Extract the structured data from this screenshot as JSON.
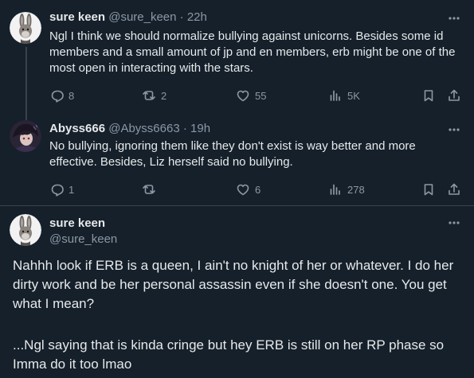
{
  "tweets": [
    {
      "name": "sure keen",
      "handle": "@sure_keen",
      "time": "· 22h",
      "text": "Ngl I think we should normalize bullying against unicorns. Besides some id members and a small amount of jp and en members, erb might be one of the most open in interacting with the stars.",
      "replies": "8",
      "reposts": "2",
      "likes": "55",
      "views": "5K"
    },
    {
      "name": "Abyss666",
      "handle": "@Abyss6663",
      "time": "· 19h",
      "text": "No bullying, ignoring them like they don't exist is way better and more effective. Besides, Liz herself said no bullying.",
      "replies": "1",
      "reposts": "",
      "likes": "6",
      "views": "278"
    }
  ],
  "main_tweet": {
    "name": "sure keen",
    "handle": "@sure_keen",
    "paragraph1": "Nahhh look if ERB is a queen, I ain't no knight of her or whatever. I do her dirty work and be her personal assassin even if she doesn't one. You get what I mean?",
    "paragraph2": "...Ngl saying that is kinda cringe but hey ERB is still on her RP phase so Imma do it too lmao"
  },
  "colors": {
    "background": "#15202b",
    "text": "#e7e9ea",
    "muted": "#8b98a5",
    "line": "#38444d"
  },
  "icons": [
    "bunny-avatar-icon",
    "anime-avatar-icon",
    "more-icon",
    "reply-icon",
    "repost-icon",
    "like-icon",
    "views-icon",
    "bookmark-icon",
    "share-icon"
  ]
}
